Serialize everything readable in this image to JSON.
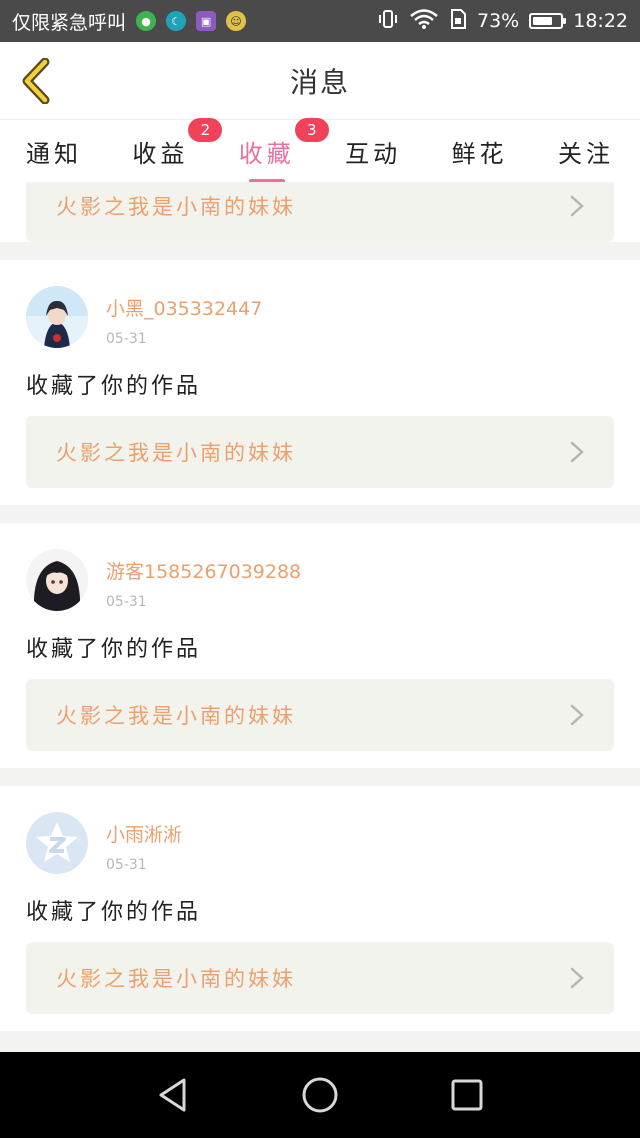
{
  "status_bar": {
    "carrier": "仅限紧急呼叫",
    "battery": "73%",
    "battery_level": 0.73,
    "time": "18:22",
    "icons": [
      "app-green-icon",
      "moon-icon",
      "gallery-icon",
      "emoji-icon",
      "vibrate-icon",
      "wifi-icon",
      "sim-icon",
      "battery-icon"
    ]
  },
  "header": {
    "title": "消息"
  },
  "tabs": [
    {
      "label": "通知",
      "badge": ""
    },
    {
      "label": "收益",
      "badge": "2"
    },
    {
      "label": "收藏",
      "badge": "3",
      "active": true
    },
    {
      "label": "互动",
      "badge": ""
    },
    {
      "label": "鲜花",
      "badge": ""
    },
    {
      "label": "关注",
      "badge": ""
    }
  ],
  "feed": {
    "partial_item": {
      "work_title": "火影之我是小南的妹妹"
    },
    "items": [
      {
        "username": "小黑_035332447",
        "date": "05-31",
        "action": "收藏了你的作品",
        "work_title": "火影之我是小南的妹妹",
        "avatar": "anime-avatar-blue"
      },
      {
        "username": "游客1585267039288",
        "date": "05-31",
        "action": "收藏了你的作品",
        "work_title": "火影之我是小南的妹妹",
        "avatar": "anime-avatar-dark"
      },
      {
        "username": "小雨淅淅",
        "date": "05-31",
        "action": "收藏了你的作品",
        "work_title": "火影之我是小南的妹妹",
        "avatar": "default-star-avatar"
      }
    ]
  },
  "colors": {
    "accent": "#e8719f",
    "username": "#eba06e",
    "badge": "#f0435a",
    "link_bg": "#f3f3ed"
  },
  "nav": {
    "icons": [
      "back-triangle-icon",
      "home-circle-icon",
      "recents-square-icon"
    ]
  }
}
